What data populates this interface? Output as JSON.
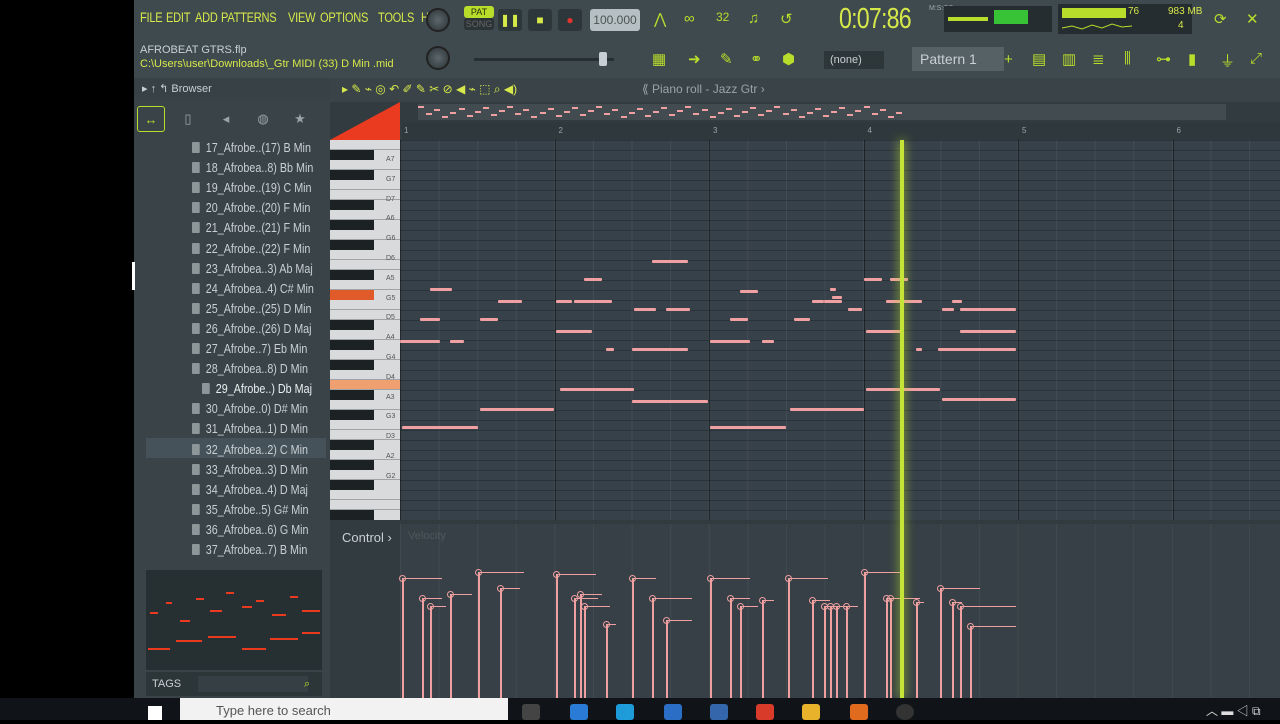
{
  "menu": [
    "FILE",
    "EDIT",
    "ADD",
    "PATTERNS",
    "VIEW",
    "OPTIONS",
    "TOOLS",
    "HELP"
  ],
  "transport": {
    "pat_label": "PAT",
    "song_label": "SONG",
    "tempo": "100.000",
    "time_main": "0:07",
    "time_sub": "86",
    "time_unit": "M:S:CS"
  },
  "stats": {
    "cpu": "76",
    "memory": "983 MB",
    "polyphony": "4"
  },
  "project": {
    "name": "AFROBEAT GTRS.flp",
    "path": "C:\\Users\\user\\Downloads\\_Gtr MIDI (33) D Min .mid"
  },
  "toolbar": {
    "channel_select": "(none)",
    "pattern": "Pattern 1"
  },
  "browser": {
    "title": "Browser",
    "selected_index": 12,
    "items": [
      "17_Afrobe..(17) B Min",
      "18_Afrobea..8) Bb Min",
      "19_Afrobe..(19) C Min",
      "20_Afrobe..(20) F Min",
      "21_Afrobe..(21) F Min",
      "22_Afrobe..(22) F Min",
      "23_Afrobea..3) Ab Maj",
      "24_Afrobea..4) C# Min",
      "25_Afrobe..(25) D Min",
      "26_Afrobe..(26) D Maj",
      "27_Afrobe..7) Eb Min",
      "28_Afrobea..8) D Min",
      "29_Afrobe..) Db Maj",
      "30_Afrobe..0) D# Min",
      "31_Afrobea..1) D Min",
      "32_Afrobea..2) C Min",
      "33_Afrobea..3) D Min",
      "34_Afrobea..4) D Maj",
      "35_Afrobe..5) G# Min",
      "36_Afrobea..6) G Min",
      "37_Afrobea..7) B Min"
    ],
    "tags_label": "TAGS"
  },
  "piano_roll": {
    "title": "Piano roll - Jazz Gtr",
    "bars": [
      "1",
      "2",
      "3",
      "4",
      "5",
      "6"
    ],
    "key_labels": [
      "A7",
      "G7",
      "D7",
      "A6",
      "G6",
      "D6",
      "A5",
      "G5",
      "D5",
      "A4",
      "G4",
      "D4",
      "A3",
      "G3",
      "D3",
      "A2",
      "G2"
    ],
    "control_label": "Control",
    "velocity_label": "Velocity"
  },
  "taskbar": {
    "search_placeholder": "Type here to search"
  }
}
